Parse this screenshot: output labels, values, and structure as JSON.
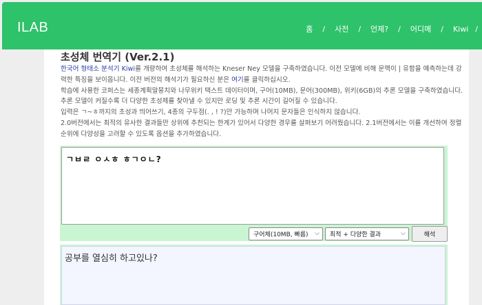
{
  "header": {
    "brand": "ILAB",
    "nav": [
      "홈",
      "사전",
      "언제?",
      "어디메",
      "Kiwi"
    ],
    "separator": "/"
  },
  "page": {
    "title": "초성체 번역기 (Ver.2.1)",
    "desc": {
      "p1_link": "한국어 형태소 분석기 Kiwi",
      "p1_text": "를 개량하여 초성체를 해석하는 Kneser Ney 모델을 구축하였습니다. 이전 모델에 비해 문맥이 | 유함을 예측하는데 강력한 특징을 보이옵니다. 이전 버전의 해석기가 필요하신 분은 ",
      "p1_link2": "여기",
      "p1_text2": "를 클릭하십시오.",
      "p2": "학습에 사용한 코퍼스는 세종계획말뭉치와 나무위키 텍스트 데이터이며, 구어(10MB), 문어(300MB), 위키(6GB)의 추론 모델을 구축하였습니다. 추론 모델이 커질수록 더 다양한 초성체를 찾아낼 수 있지만 로딩 및 추론 시간이 길어질 수 있습니다.",
      "p3": "입력은 ㄱ~ㅎ까지의 초성과 띄어쓰기, 4종의 구두점(. , ! ?)만 가능하며 나머지 문자들은 인식하지 않습니다.",
      "p4": "2.0버전에서는 최적의 유사한 결과들만 상위에 추천되는 한계가 있어서 다양한 경우를 살펴보기 어려웠습니다. 2.1버전에서는 이를 개선하여 정렬 순위에 다양성을 고려할 수 있도록 옵션을 추가하였습니다."
    }
  },
  "input": {
    "value": "ㄱㅂㄹ ㅇㅅㅎ ㅎㄱㅇㄴ?"
  },
  "controls": {
    "model_selected": "구어체(10MB, 빠름)",
    "mode_selected": "최적 + 다양한 결과",
    "submit_label": "해석"
  },
  "output": {
    "value": "공부를 열심히 하고있나?"
  },
  "colors": {
    "header_bg": "#2ec26a",
    "link": "#2a3aa8",
    "panel_bg": "#c9f5d3"
  }
}
